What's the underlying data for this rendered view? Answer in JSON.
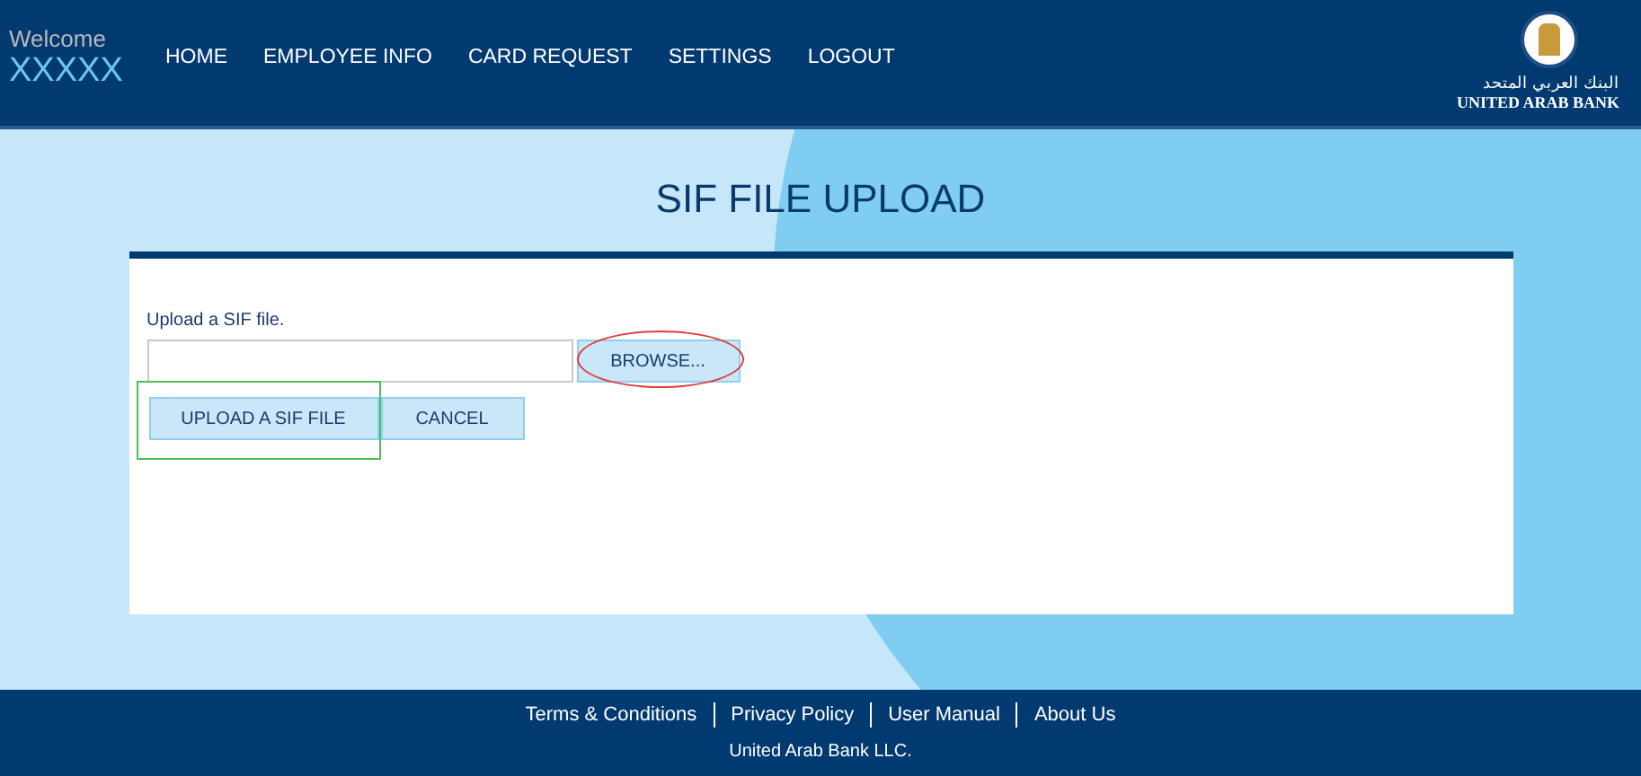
{
  "header": {
    "welcome": "Welcome",
    "user": "XXXXX",
    "nav": [
      {
        "label": "HOME"
      },
      {
        "label": "EMPLOYEE INFO"
      },
      {
        "label": "CARD REQUEST"
      },
      {
        "label": "SETTINGS"
      },
      {
        "label": "LOGOUT"
      }
    ],
    "logo": {
      "arabic": "البنك العربي المتحد",
      "name": "UNITED ARAB BANK"
    }
  },
  "page_title": "SIF FILE UPLOAD",
  "form": {
    "label": "Upload a SIF file.",
    "browse": "BROWSE...",
    "upload": "UPLOAD A SIF FILE",
    "cancel": "CANCEL"
  },
  "footer": {
    "links": [
      "Terms & Conditions",
      "Privacy Policy",
      "User Manual",
      "About Us"
    ],
    "copyright": "United Arab Bank LLC."
  }
}
